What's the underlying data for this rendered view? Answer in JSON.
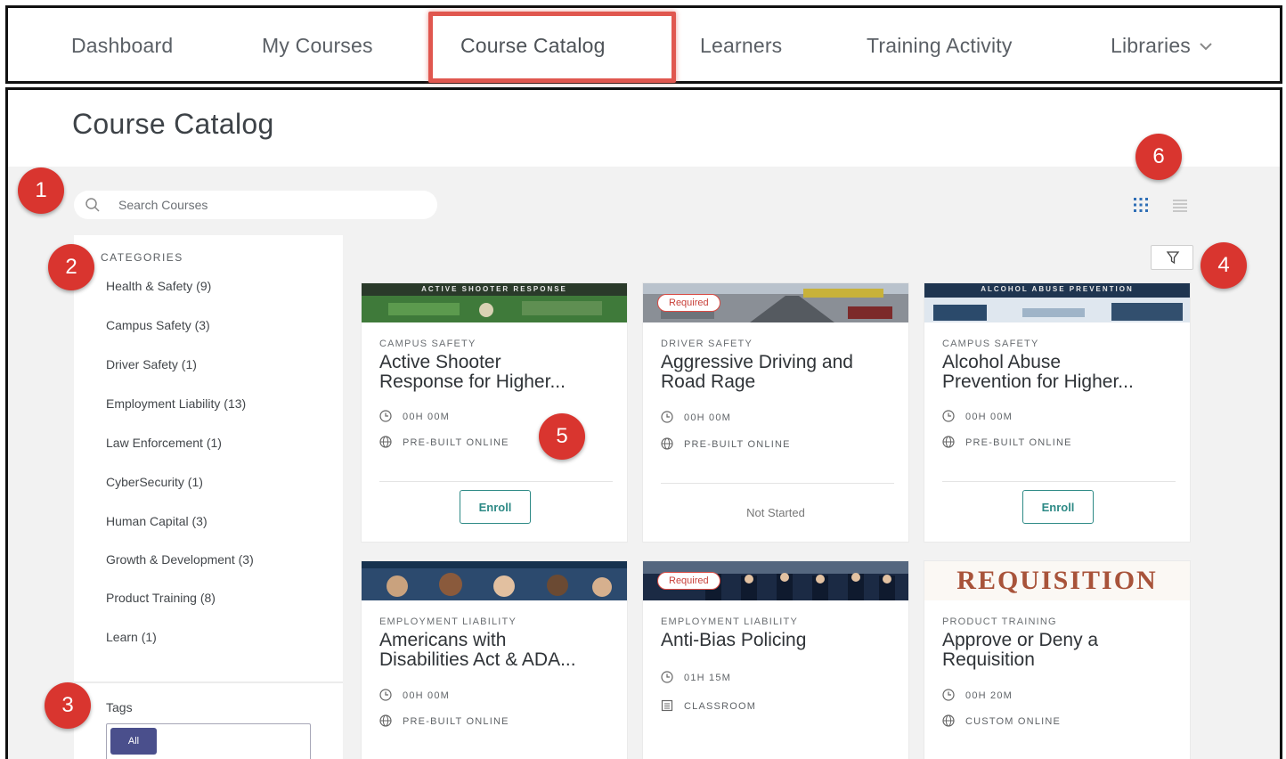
{
  "nav": {
    "items": [
      "Dashboard",
      "My Courses",
      "Course Catalog",
      "Learners",
      "Training Activity",
      "Libraries"
    ],
    "active": "Course Catalog"
  },
  "page": {
    "title": "Course Catalog"
  },
  "search": {
    "placeholder": "Search Courses",
    "icon": "search-icon"
  },
  "view_toggle": {
    "grid_icon": "grid-view-icon",
    "list_icon": "list-view-icon",
    "selected": "grid"
  },
  "filter": {
    "icon": "filter-icon"
  },
  "sidebar": {
    "categories_heading": "CATEGORIES",
    "categories": [
      "Health & Safety (9)",
      "Campus Safety (3)",
      "Driver Safety (1)",
      "Employment Liability (13)",
      "Law Enforcement (1)",
      "CyberSecurity (1)",
      "Human Capital (3)",
      "Growth & Development (3)",
      "Product Training (8)",
      "Learn (1)"
    ],
    "tags_label": "Tags",
    "tag_all": "All"
  },
  "cards": [
    {
      "banner": "ACTIVE SHOOTER RESPONSE",
      "required": "",
      "category": "CAMPUS SAFETY",
      "title_line1": "Active Shooter",
      "title_line2": "Response for Higher...",
      "duration": "00H 00M",
      "format": "PRE-BUILT ONLINE",
      "action": "Enroll"
    },
    {
      "banner": "",
      "required": "Required",
      "category": "DRIVER SAFETY",
      "title_line1": "Aggressive Driving and",
      "title_line2": "Road Rage",
      "duration": "00H 00M",
      "format": "PRE-BUILT ONLINE",
      "status": "Not Started"
    },
    {
      "banner": "ALCOHOL ABUSE PREVENTION",
      "required": "",
      "category": "CAMPUS SAFETY",
      "title_line1": "Alcohol Abuse",
      "title_line2": "Prevention for Higher...",
      "duration": "00H 00M",
      "format": "PRE-BUILT ONLINE",
      "action": "Enroll"
    },
    {
      "banner": "",
      "required": "",
      "category": "EMPLOYMENT LIABILITY",
      "title_line1": "Americans with",
      "title_line2": "Disabilities Act & ADA...",
      "duration": "00H 00M",
      "format": "PRE-BUILT ONLINE"
    },
    {
      "banner": "",
      "required": "Required",
      "category": "EMPLOYMENT LIABILITY",
      "title_line1": "Anti-Bias Policing",
      "title_line2": "",
      "duration": "01H 15M",
      "format": "CLASSROOM"
    },
    {
      "banner": "REQUISITION",
      "required": "",
      "category": "PRODUCT TRAINING",
      "title_line1": "Approve or Deny a",
      "title_line2": "Requisition",
      "duration": "00H 20M",
      "format": "CUSTOM ONLINE"
    }
  ],
  "callouts": [
    "1",
    "2",
    "3",
    "4",
    "5",
    "6"
  ],
  "colors": {
    "callout": "#d9352f",
    "highlight": "#e0574f",
    "accent_teal": "#2e8a86",
    "tag_all_bg": "#4a4f8c"
  }
}
